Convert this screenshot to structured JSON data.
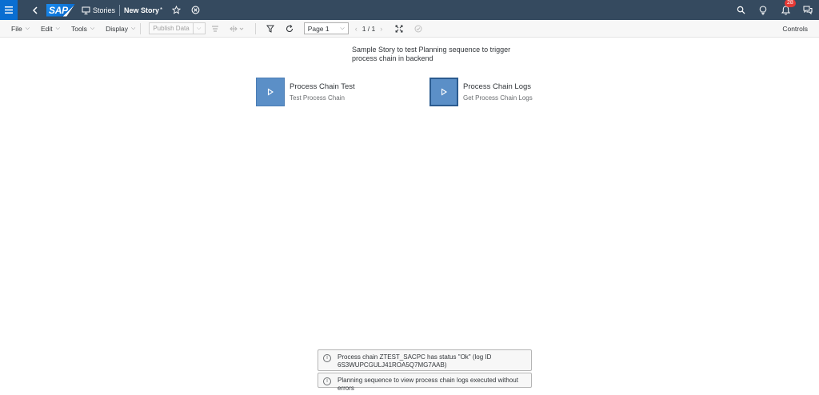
{
  "shell": {
    "logo_text": "SAP",
    "stories_label": "Stories",
    "story_title": "New Story",
    "unsaved_marker": "*",
    "notification_count": "28"
  },
  "toolbar": {
    "file": "File",
    "edit": "Edit",
    "tools": "Tools",
    "display": "Display",
    "publish_data": "Publish Data",
    "page_selected": "Page 1",
    "page_counter": "1 / 1",
    "controls": "Controls"
  },
  "canvas": {
    "description": "Sample Story to test Planning sequence to trigger process chain in backend",
    "tiles": [
      {
        "title": "Process Chain Test",
        "subtitle": "Test Process Chain"
      },
      {
        "title": "Process Chain Logs",
        "subtitle": "Get Process Chain Logs"
      }
    ]
  },
  "messages": [
    "Process chain ZTEST_SACPC has status \"Ok\" (log ID 6S3WUPCGULJ41ROA5Q7MG7AAB)",
    "Planning sequence to view process chain logs executed without errors"
  ],
  "colors": {
    "shell_bg": "#354a5f",
    "accent": "#0a6ed1",
    "tile_blue": "#5b8fc7"
  }
}
